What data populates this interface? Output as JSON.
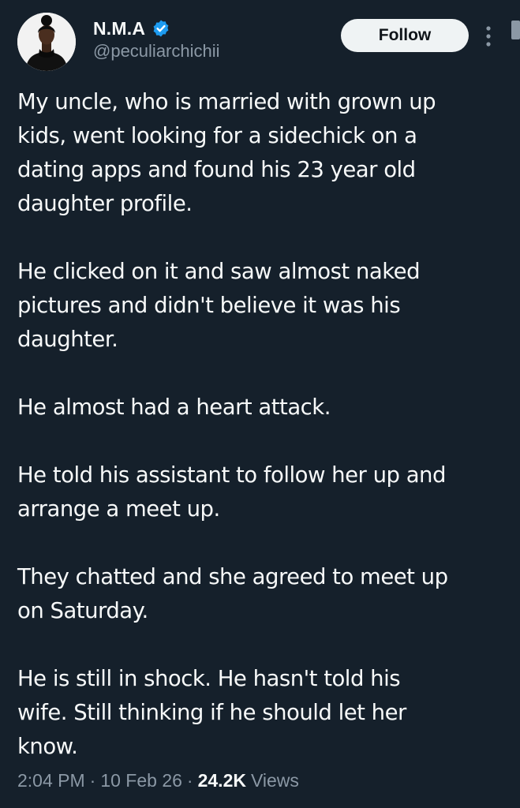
{
  "author": {
    "display_name": "N.M.A",
    "handle": "@peculiarchichii",
    "verified_icon": "verified-badge-icon",
    "accent_color": "#1d9bf0"
  },
  "actions": {
    "follow_label": "Follow",
    "more_icon": "more-vertical-icon"
  },
  "tweet": {
    "paragraphs": [
      "My uncle, who is married with grown up\nkids, went looking for a sidechick on a\ndating apps and found his 23 year old\ndaughter profile.",
      "He clicked on it and saw almost naked\npictures and didn't believe it was his\ndaughter.",
      "He almost had a heart attack.",
      "He told his assistant to follow her up and\narrange a meet up.",
      "They chatted and she agreed to meet up\non Saturday.",
      "He is still in shock. He hasn't told his\nwife. Still thinking if he should let her\nknow."
    ]
  },
  "meta": {
    "time": "2:04 PM",
    "separator": "·",
    "date": "10 Feb 26",
    "views_count": "24.2K",
    "views_label": "Views"
  },
  "colors": {
    "background": "#15202b",
    "text": "#f7f9f9",
    "secondary_text": "#8b98a5",
    "button_bg": "#eff3f4"
  }
}
